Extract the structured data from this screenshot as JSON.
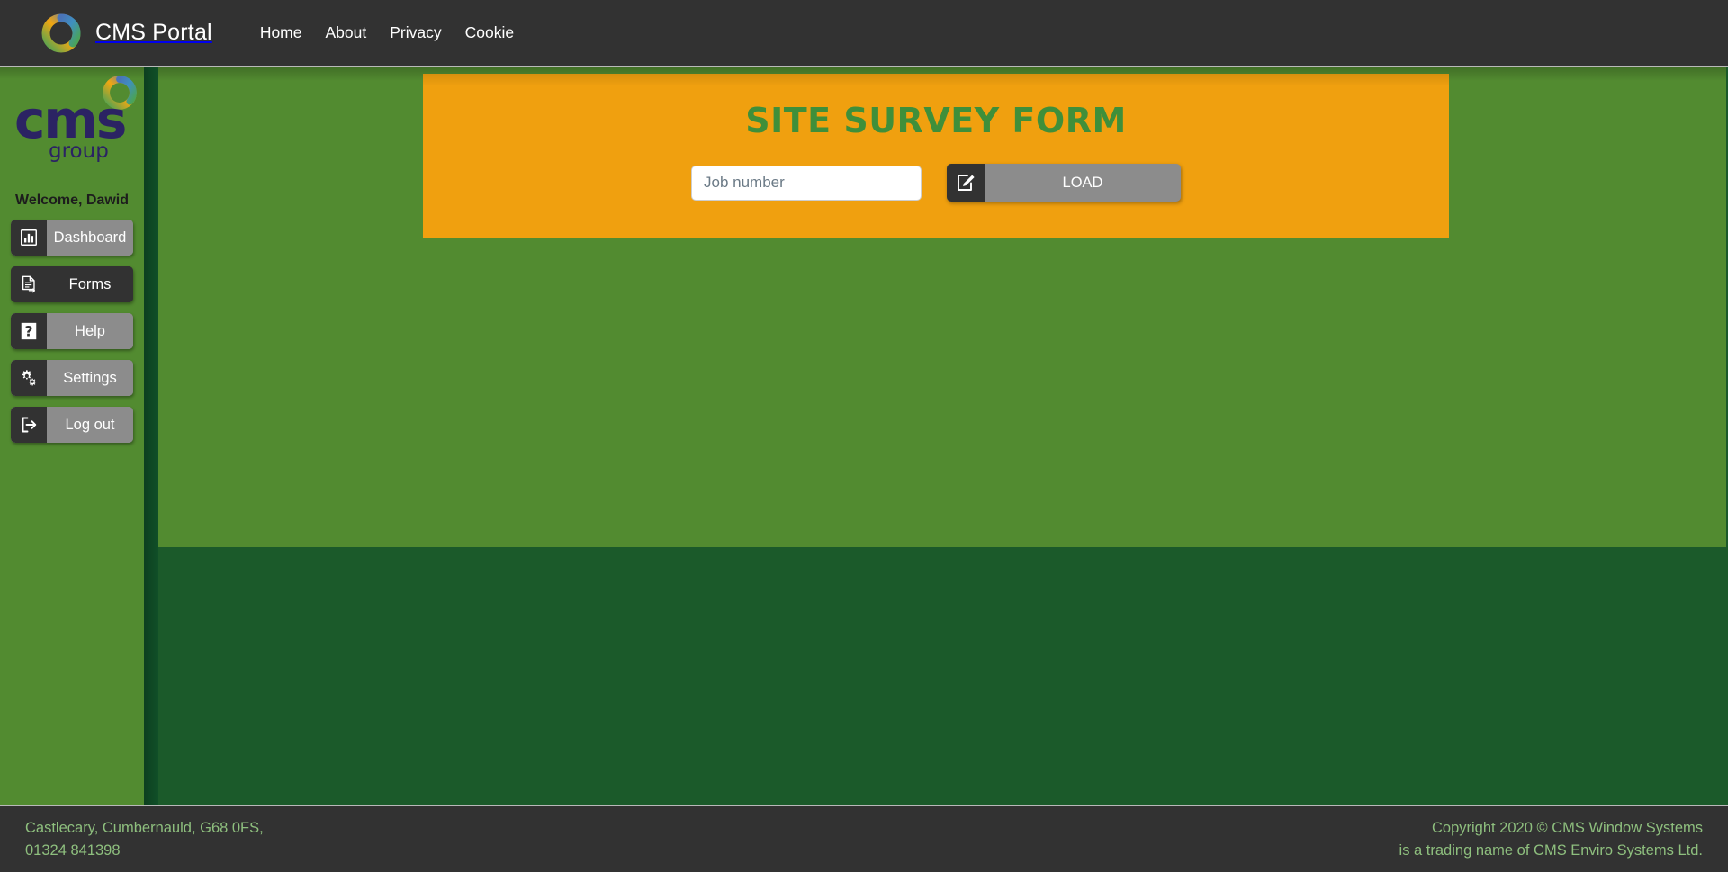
{
  "navbar": {
    "brand_title": "CMS Portal",
    "logo_icon": "cms-ring-logo-icon",
    "links": [
      {
        "label": "Home",
        "name": "nav-link-home"
      },
      {
        "label": "About",
        "name": "nav-link-about"
      },
      {
        "label": "Privacy",
        "name": "nav-link-privacy"
      },
      {
        "label": "Cookie",
        "name": "nav-link-cookie"
      }
    ]
  },
  "sidebar": {
    "logo_word": "cms",
    "logo_tm": "™",
    "logo_sub": "group",
    "logo_mark_icon": "cms-ring-logo-icon",
    "welcome": "Welcome, Dawid",
    "items": [
      {
        "label": "Dashboard",
        "icon": "bar-chart-icon",
        "style": "gray",
        "name": "sidebar-item-dashboard"
      },
      {
        "label": "Forms",
        "icon": "document-arrow-icon",
        "style": "dark",
        "name": "sidebar-item-forms"
      },
      {
        "label": "Help",
        "icon": "question-mark-icon",
        "style": "gray",
        "name": "sidebar-item-help"
      },
      {
        "label": "Settings",
        "icon": "gears-icon",
        "style": "gray",
        "name": "sidebar-item-settings"
      },
      {
        "label": "Log out",
        "icon": "logout-arrow-icon",
        "style": "gray",
        "name": "sidebar-item-logout"
      }
    ]
  },
  "panel": {
    "title": "SITE SURVEY FORM",
    "job_input_value": "",
    "job_input_placeholder": "Job number",
    "load_label": "LOAD",
    "load_icon": "edit-square-pencil-icon"
  },
  "footer": {
    "address_line1": "Castlecary, Cumbernauld, G68 0FS,",
    "address_line2": "01324 841398",
    "copyright_line1": "Copyright 2020 © CMS Window Systems",
    "copyright_line2": "is a trading name of CMS Enviro Systems Ltd."
  },
  "colors": {
    "navbar_bg": "#323232",
    "sidebar_green": "#528b30",
    "content_green": "#528b30",
    "page_dark_green": "#1b5a2a",
    "panel_orange": "#f0a00f",
    "title_green": "#3f8f3a",
    "button_gray": "#8c8c8c",
    "button_dark": "#323232",
    "footer_text_green": "#8ebf7e",
    "logo_navy": "#2b2363"
  }
}
